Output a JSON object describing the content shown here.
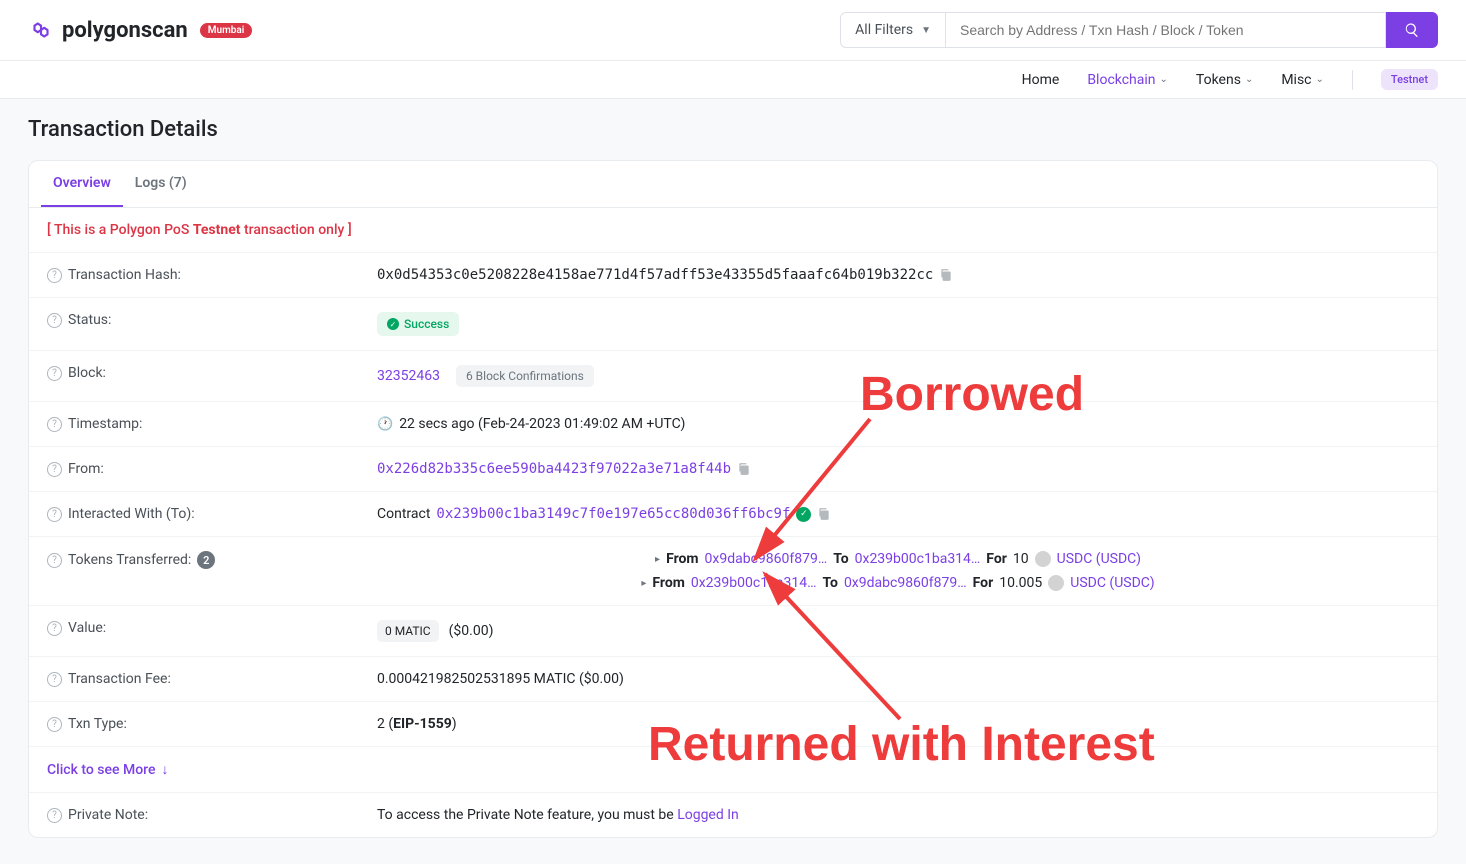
{
  "logo": {
    "text": "polygonscan",
    "badge": "Mumbai"
  },
  "search": {
    "filter_label": "All Filters",
    "placeholder": "Search by Address / Txn Hash / Block / Token"
  },
  "nav": {
    "home": "Home",
    "blockchain": "Blockchain",
    "tokens": "Tokens",
    "misc": "Misc",
    "testnet": "Testnet"
  },
  "page_title": "Transaction Details",
  "tabs": {
    "overview": "Overview",
    "logs": "Logs (7)"
  },
  "notice": {
    "prefix": "[ This is a Polygon PoS ",
    "bold": "Testnet",
    "suffix": " transaction only ]"
  },
  "rows": {
    "txhash_label": "Transaction Hash:",
    "txhash_value": "0x0d54353c0e5208228e4158ae771d4f57adff53e43355d5faaafc64b019b322cc",
    "status_label": "Status:",
    "status_value": "Success",
    "block_label": "Block:",
    "block_value": "32352463",
    "block_conf": "6 Block Confirmations",
    "timestamp_label": "Timestamp:",
    "timestamp_value": "22 secs ago (Feb-24-2023 01:49:02 AM +UTC)",
    "from_label": "From:",
    "from_value": "0x226d82b335c6ee590ba4423f97022a3e71a8f44b",
    "to_label": "Interacted With (To):",
    "to_prefix": "Contract",
    "to_value": "0x239b00c1ba3149c7f0e197e65cc80d036ff6bc9f",
    "tokens_label": "Tokens Transferred:",
    "tokens_count": "2",
    "value_label": "Value:",
    "value_badge": "0 MATIC",
    "value_usd": "($0.00)",
    "fee_label": "Transaction Fee:",
    "fee_value": "0.000421982502531895 MATIC ($0.00)",
    "txntype_label": "Txn Type:",
    "txntype_prefix": "2 (",
    "txntype_bold": "EIP-1559",
    "txntype_suffix": ")",
    "more_link": "Click to see More",
    "note_label": "Private Note:",
    "note_prefix": "To access the Private Note feature, you must be ",
    "note_link": "Logged In"
  },
  "transfers": [
    {
      "from_label": "From",
      "from": "0x9dabc9860f879…",
      "to_label": "To",
      "to": "0x239b00c1ba314…",
      "for_label": "For",
      "amount": "10",
      "token": "USDC (USDC)"
    },
    {
      "from_label": "From",
      "from": "0x239b00c1ba314…",
      "to_label": "To",
      "to": "0x9dabc9860f879…",
      "for_label": "For",
      "amount": "10.005",
      "token": "USDC (USDC)"
    }
  ],
  "annotations": {
    "borrowed": "Borrowed",
    "returned": "Returned with Interest"
  }
}
